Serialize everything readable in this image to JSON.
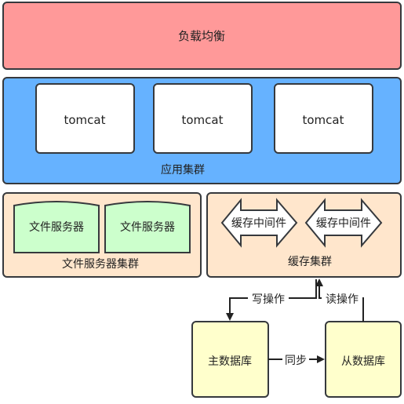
{
  "load_balancer": {
    "label": "负载均衡",
    "color": "#FF9999"
  },
  "app_cluster": {
    "label": "应用集群",
    "color": "#66B2FF",
    "servers": [
      "tomcat",
      "tomcat",
      "tomcat"
    ]
  },
  "file_cluster": {
    "label": "文件服务器集群",
    "color": "#FFE6CC",
    "servers": [
      "文件服务器",
      "文件服务器"
    ],
    "server_color": "#CCFFCC"
  },
  "cache_cluster": {
    "label": "缓存集群",
    "color": "#FFE6CC",
    "middlewares": [
      "缓存中间件",
      "缓存中间件"
    ]
  },
  "databases": {
    "master": "主数据库",
    "slave": "从数据库",
    "color": "#FFFFCC"
  },
  "edges": {
    "write": "写操作",
    "read": "读操作",
    "sync": "同步"
  }
}
